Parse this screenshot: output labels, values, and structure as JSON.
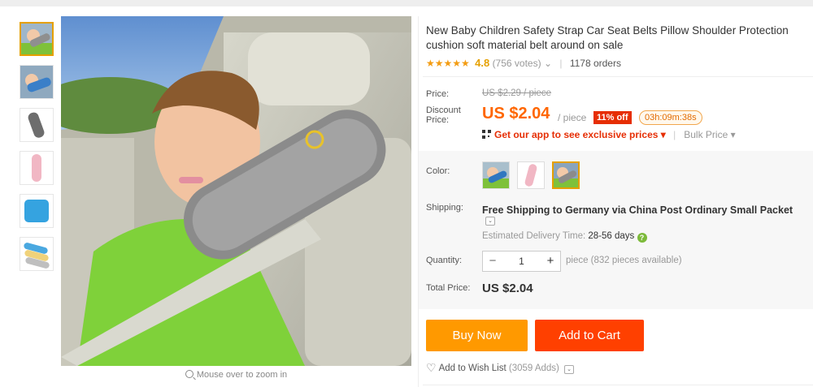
{
  "product": {
    "title": "New Baby Children Safety Strap Car Seat Belts Pillow Shoulder Protection cushion soft material belt around on sale",
    "zoom_hint": "Mouse over to zoom in"
  },
  "rating": {
    "stars": "★★★★★",
    "value": "4.8",
    "votes": "(756 votes)",
    "votes_chevron": "⌄",
    "orders": "1178 orders"
  },
  "price": {
    "label": "Price:",
    "original": "US $2.29 / piece",
    "discount_label": "Discount Price:",
    "current": "US $2.04",
    "unit": "/ piece",
    "off_badge": "11% off",
    "timer": "03h:09m:38s",
    "app_link": "Get our app to see exclusive prices ▾",
    "bulk_link": "Bulk Price ▾"
  },
  "color": {
    "label": "Color:",
    "options": [
      "grey-blue pillow",
      "pink pillow",
      "grey pillow"
    ],
    "selected_index": 2
  },
  "shipping": {
    "label": "Shipping:",
    "text": "Free Shipping to Germany via China Post Ordinary Small Packet",
    "toggle": "⌄",
    "delivery_label": "Estimated Delivery Time:",
    "delivery_days": "28-56 days",
    "help": "?"
  },
  "quantity": {
    "label": "Quantity:",
    "minus": "−",
    "value": "1",
    "plus": "+",
    "note": "piece (832 pieces available)"
  },
  "total": {
    "label": "Total Price:",
    "value": "US $2.04"
  },
  "actions": {
    "buy_now": "Buy Now",
    "add_to_cart": "Add to Cart",
    "wishlist_icon": "♡",
    "wishlist": "Add to Wish List",
    "wishlist_count": "(3059 Adds)",
    "wishlist_toggle": "⌄"
  },
  "colors": {
    "accent_orange": "#ff6600",
    "buy_button": "#ff9900",
    "cart_button": "#ff4000",
    "badge_red": "#e62e04",
    "star_gold": "#f39c12"
  }
}
